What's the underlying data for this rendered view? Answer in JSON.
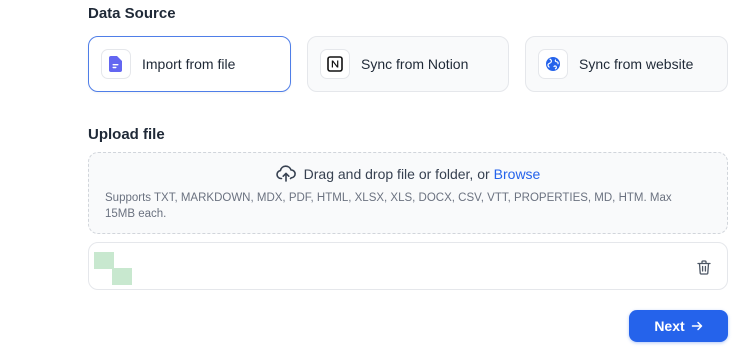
{
  "data_source": {
    "title": "Data Source",
    "options": [
      {
        "label": "Import from file",
        "icon": "file-doc-icon",
        "selected": true
      },
      {
        "label": "Sync from Notion",
        "icon": "notion-icon",
        "selected": false
      },
      {
        "label": "Sync from website",
        "icon": "globe-icon",
        "selected": false
      }
    ]
  },
  "upload": {
    "title": "Upload file",
    "drop_text": "Drag and drop file or folder, or",
    "browse_label": "Browse",
    "supports_text": "Supports TXT, MARKDOWN, MDX, PDF, HTML, XLSX, XLS, DOCX, CSV, VTT, PROPERTIES, MD, HTM. Max 15MB each."
  },
  "actions": {
    "next_label": "Next"
  },
  "colors": {
    "accent": "#2563eb",
    "selected_border": "#4f7ee8",
    "file_icon": "#6366f1",
    "thumb": "#c8e8cf"
  }
}
